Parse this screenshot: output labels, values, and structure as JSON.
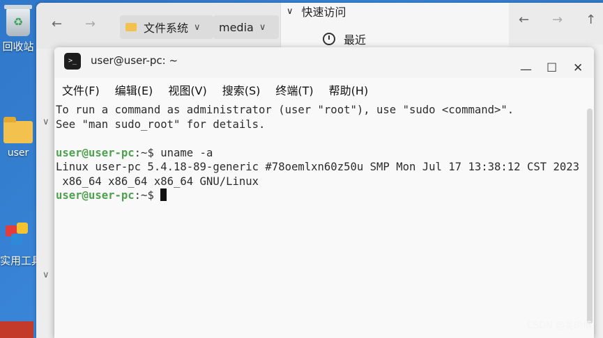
{
  "desktop": {
    "trash_label": "回收站",
    "user_folder_label": "user",
    "tools_label": "实用工具"
  },
  "file_manager": {
    "breadcrumb_root": "文件系统",
    "breadcrumb_current": "media",
    "quick_access": "快速访问",
    "recent": "最近"
  },
  "terminal": {
    "title": "user@user-pc: ~",
    "menu": [
      "文件(F)",
      "编辑(E)",
      "视图(V)",
      "搜索(S)",
      "终端(T)",
      "帮助(H)"
    ],
    "lines": {
      "l1": "To run a command as administrator (user \"root\"), use \"sudo <command>\".",
      "l2": "See \"man sudo_root\" for details.",
      "prompt_user": "user@user-pc",
      "prompt_path": ":~$",
      "cmd": " uname -a",
      "out1": "Linux user-pc 5.4.18-89-generic #78oemlxn60z50u SMP Mon Jul 17 13:38:12 CST 2023",
      "out2": " x86_64 x86_64 x86_64 GNU/Linux"
    }
  },
  "watermark": "CSDN @吴師傅"
}
